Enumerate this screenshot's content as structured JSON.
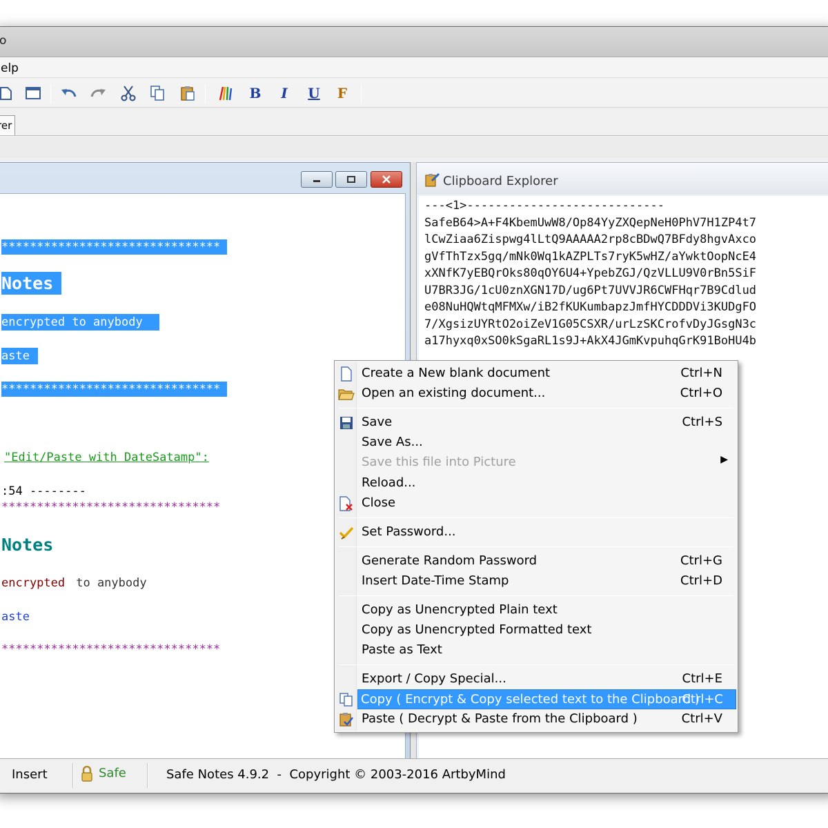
{
  "window": {
    "title_fragment": "o"
  },
  "menu": {
    "help": "elp"
  },
  "toolbar": {
    "bold": "B",
    "italic": "I",
    "underline": "U",
    "font": "F",
    "icons": [
      "new-icon",
      "window-icon",
      "undo-icon",
      "redo-icon",
      "cut-icon",
      "copy-icon",
      "paste-icon",
      "color-icon",
      "bold-icon",
      "italic-icon",
      "underline-icon",
      "font-icon"
    ]
  },
  "tabs": {
    "active": "rer"
  },
  "editor": {
    "lines": {
      "l1": "*******************************",
      "l2": "Notes",
      "l3": "encrypted to anybody ",
      "l4": "aste",
      "l5": "*******************************",
      "l6": "\"Edit/Paste with DateSatamp\":",
      "l7": ":54 --------",
      "l8": "*******************************",
      "l9": "Notes",
      "l10_a": "encrypted",
      "l10_b": " to anybody",
      "l11": "aste",
      "l12": "*******************************"
    },
    "colors": {
      "selection": "#3399ff",
      "teal": "#008080",
      "green": "#1a9a1a",
      "maroon": "#800000",
      "purple": "#9b2c9b",
      "blue": "#1f3fe0"
    }
  },
  "clipboard": {
    "title": "Clipboard Explorer",
    "lines": [
      "---<1>----------------------------",
      "SafeB64>A+F4KbemUwW8/Op84YyZXQepNeH0PhV7H1ZP4t7",
      "lCwZiaa6Zispwg4lLtQ9AAAAA2rp8cBDwQ7BFdy8hgvAxco",
      "gVfThTzx5gq/mNk0Wq1kAZPLTs7ryK5wHZ/aYwktOopNcE4",
      "xXNfK7yEBQrOks80qOY6U4+YpebZGJ/QzVLLU9V0rBn5SiF",
      "U7BR3JG/1cU0znXGN17D/ug6Pt7UVVJR6CWFHqr7B9Cdlud",
      "e08NuHQWtqMFMXw/iB2fKUKumbapzJmfHYCDDDVi3KUDgFO",
      "7/XgsizUYRtO2oiZeV1G05CSXR/urLzSKCrofvDyJGsgN3c",
      "a17hyxq0xSO0kSgaRL1s9J+AkX4JGmKvpuhqGrK91BoHU4b"
    ]
  },
  "status": {
    "mode": "Insert",
    "safe": "Safe",
    "info": "Safe Notes 4.9.2  -  Copyright © 2003-2016 ArtbyMind"
  },
  "context_menu": {
    "items": [
      {
        "label": "Create a New blank document",
        "shortcut": "Ctrl+N",
        "icon": "new-document-icon"
      },
      {
        "label": "Open an existing document...",
        "shortcut": "Ctrl+O",
        "icon": "open-folder-icon"
      },
      {
        "label": "Save",
        "shortcut": "Ctrl+S",
        "icon": "save-icon"
      },
      {
        "label": "Save As...",
        "shortcut": ""
      },
      {
        "label": "Save this file into Picture",
        "shortcut": "",
        "disabled": true,
        "submenu": true
      },
      {
        "label": "Reload...",
        "shortcut": ""
      },
      {
        "label": "Close",
        "shortcut": "",
        "icon": "close-document-icon"
      },
      {
        "label": "Set Password...",
        "shortcut": "",
        "icon": "password-icon"
      },
      {
        "label": "Generate Random Password",
        "shortcut": "Ctrl+G"
      },
      {
        "label": "Insert Date-Time Stamp",
        "shortcut": "Ctrl+D"
      },
      {
        "label": "Copy as Unencrypted Plain text",
        "shortcut": ""
      },
      {
        "label": "Copy as Unencrypted Formatted text",
        "shortcut": ""
      },
      {
        "label": "Paste as Text",
        "shortcut": ""
      },
      {
        "label": "Export / Copy Special...",
        "shortcut": "Ctrl+E"
      },
      {
        "label": "Copy ( Encrypt & Copy selected text to the Clipboard )",
        "shortcut": "Ctrl+C",
        "icon": "copy-icon",
        "highlighted": true
      },
      {
        "label": "Paste ( Decrypt & Paste from the Clipboard )",
        "shortcut": "Ctrl+V",
        "icon": "paste-icon"
      }
    ],
    "highlight_color": "#3399ff"
  }
}
